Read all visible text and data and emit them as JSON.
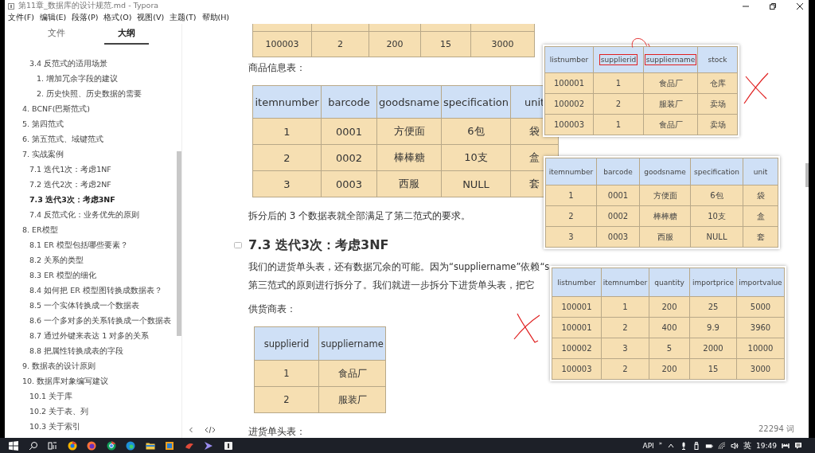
{
  "window": {
    "title": "第11章_数据库的设计规范.md - Typora"
  },
  "menu": [
    "文件(F)",
    "编辑(E)",
    "段落(P)",
    "格式(O)",
    "视图(V)",
    "主题(T)",
    "帮助(H)"
  ],
  "sidebar": {
    "tabs": [
      {
        "label": "文件",
        "selected": false
      },
      {
        "label": "大纲",
        "selected": true
      }
    ],
    "outline": [
      {
        "children": [
          {
            "label": "3.4 反范式的适用场景",
            "selected": false,
            "children": [
              {
                "label": "1. 增加冗余字段的建议",
                "selected": false
              },
              {
                "label": "2. 历史快照、历史数据的需要",
                "selected": false
              }
            ]
          }
        ]
      },
      {
        "label": "4. BCNF(巴斯范式)",
        "selected": false
      },
      {
        "label": "5. 第四范式",
        "selected": false
      },
      {
        "label": "6. 第五范式、域键范式",
        "selected": false
      },
      {
        "label": "7. 实战案例",
        "selected": false,
        "children": [
          {
            "label": "7.1 迭代1次：考虑1NF",
            "selected": false
          },
          {
            "label": "7.2 迭代2次：考虑2NF",
            "selected": false
          },
          {
            "label": "7.3 迭代3次：考虑3NF",
            "selected": true
          },
          {
            "label": "7.4 反范式化：业务优先的原则",
            "selected": false
          }
        ]
      },
      {
        "label": "8. ER模型",
        "selected": false,
        "children": [
          {
            "label": "8.1 ER 模型包括哪些要素？",
            "selected": false
          },
          {
            "label": "8.2 关系的类型",
            "selected": false
          },
          {
            "label": "8.3 ER 模型的细化",
            "selected": false
          },
          {
            "label": "8.4 如何把 ER 模型图转换成数据表？",
            "selected": false
          },
          {
            "label": "8.5 一个实体转换成一个数据表",
            "selected": false
          },
          {
            "label": "8.6 一个多对多的关系转换成一个数据表",
            "selected": false
          },
          {
            "label": "8.7 通过外键来表达 1 对多的关系",
            "selected": false
          },
          {
            "label": "8.8 把属性转换成表的字段",
            "selected": false
          }
        ]
      },
      {
        "label": "9. 数据表的设计原则",
        "selected": false
      },
      {
        "label": "10. 数据库对象编写建议",
        "selected": false,
        "children": [
          {
            "label": "10.1 关于库",
            "selected": false
          },
          {
            "label": "10.2 关于表、列",
            "selected": false
          },
          {
            "label": "10.3 关于索引",
            "selected": false
          }
        ]
      }
    ]
  },
  "document": {
    "top_table": {
      "rows": [
        [
          "100003",
          "2",
          "200",
          "15",
          "3000"
        ]
      ]
    },
    "goods_label": "商品信息表：",
    "goods_table": {
      "columns": [
        "itemnumber",
        "barcode",
        "goodsname",
        "specification",
        "unit"
      ],
      "rows": [
        [
          "1",
          "0001",
          "方便面",
          "6包",
          "袋"
        ],
        [
          "2",
          "0002",
          "棒棒糖",
          "10支",
          "盒"
        ],
        [
          "3",
          "0003",
          "西服",
          "NULL",
          "套"
        ]
      ]
    },
    "summary": "拆分后的 3 个数据表就全部满足了第二范式的要求。",
    "heading": "7.3 迭代3次：考虑3NF",
    "paragraph_lines": [
      "我们的进货单头表，还有数据冗余的可能。因为“suppliername”依赖“s",
      "第三范式的原则进行拆分了。我们就进一步拆分下进货单头表，把它"
    ],
    "supplier_label": "供货商表：",
    "supplier_table": {
      "columns": [
        "supplierid",
        "suppliername"
      ],
      "rows": [
        [
          "1",
          "食品厂"
        ],
        [
          "2",
          "服装厂"
        ]
      ]
    },
    "order_label": "进货单头表：",
    "word_count": "22294 词"
  },
  "pasted_tables": [
    {
      "columns": [
        {
          "label": "listnumber",
          "marked": false
        },
        {
          "label": "supplierid",
          "marked": true
        },
        {
          "label": "suppliername",
          "marked": true
        },
        {
          "label": "stock",
          "marked": false
        }
      ],
      "rows": [
        [
          "100001",
          "1",
          "食品厂",
          "仓库"
        ],
        [
          "100002",
          "2",
          "服装厂",
          "卖场"
        ],
        [
          "100003",
          "1",
          "食品厂",
          "卖场"
        ]
      ]
    },
    {
      "columns": [
        {
          "label": "itemnumber",
          "marked": false
        },
        {
          "label": "barcode",
          "marked": false
        },
        {
          "label": "goodsname",
          "marked": false
        },
        {
          "label": "specification",
          "marked": false
        },
        {
          "label": "unit",
          "marked": false
        }
      ],
      "rows": [
        [
          "1",
          "0001",
          "方便面",
          "6包",
          "袋"
        ],
        [
          "2",
          "0002",
          "棒棒糖",
          "10支",
          "盒"
        ],
        [
          "3",
          "0003",
          "西服",
          "NULL",
          "套"
        ]
      ]
    },
    {
      "columns": [
        {
          "label": "listnumber",
          "marked": false
        },
        {
          "label": "itemnumber",
          "marked": false
        },
        {
          "label": "quantity",
          "marked": false
        },
        {
          "label": "importprice",
          "marked": false
        },
        {
          "label": "importvalue",
          "marked": false
        }
      ],
      "rows": [
        [
          "100001",
          "1",
          "200",
          "25",
          "5000"
        ],
        [
          "100001",
          "2",
          "400",
          "9.9",
          "3960"
        ],
        [
          "100002",
          "3",
          "5",
          "2000",
          "10000"
        ],
        [
          "100003",
          "2",
          "200",
          "15",
          "3000"
        ]
      ]
    }
  ],
  "taskbar": {
    "api": "API",
    "chevron": "»",
    "ime": "英",
    "time": "19:49"
  }
}
